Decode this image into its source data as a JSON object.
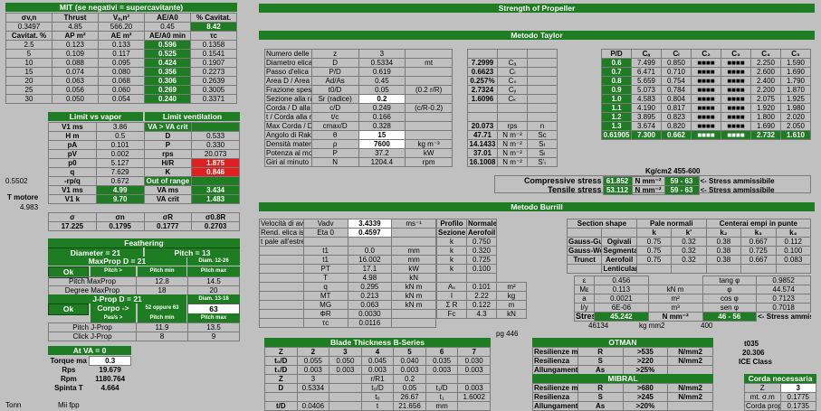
{
  "mit": {
    "title": "MIT (se negativi = supercavitante)",
    "h1": [
      "σv,n",
      "Thrust",
      "Vₐ,n²",
      "AE/A0",
      "% Cavitat."
    ],
    "r1": [
      "0.3497",
      "4.85",
      "566.20",
      "0.45",
      "8.42"
    ],
    "h2": [
      "Cavitat. %",
      "AP m²",
      "AE m²",
      "AE/A0 min",
      "τc"
    ],
    "rows": [
      [
        "2.5",
        "0.123",
        "0.133",
        "0.596",
        "0.1358"
      ],
      [
        "5",
        "0.109",
        "0.117",
        "0.525",
        "0.1541"
      ],
      [
        "10",
        "0.088",
        "0.095",
        "0.424",
        "0.1907"
      ],
      [
        "15",
        "0.074",
        "0.080",
        "0.356",
        "0.2273"
      ],
      [
        "20",
        "0.063",
        "0.068",
        "0.306",
        "0.2639"
      ],
      [
        "25",
        "0.056",
        "0.060",
        "0.269",
        "0.3005"
      ],
      [
        "30",
        "0.050",
        "0.054",
        "0.240",
        "0.3371"
      ]
    ]
  },
  "limit": {
    "t1": "Limit vs vapor",
    "t2": "Limit ventilation",
    "rows": [
      [
        "V1 ms",
        "3.86",
        "VA > VA crit",
        ""
      ],
      [
        "H m",
        "0.5",
        "D",
        "0.533"
      ],
      [
        "pA",
        "0.101",
        "P",
        "0.330"
      ],
      [
        "pV",
        "0.002",
        "rps",
        "20.073"
      ],
      [
        "p0",
        "5.127",
        "H/R",
        "1.875"
      ],
      [
        "q",
        "7.629",
        "K",
        "0.846"
      ],
      [
        "-rp/q",
        "0.672",
        "Out of range",
        ""
      ],
      [
        "V1 ms",
        "4.99",
        "VA ms",
        "3.434"
      ],
      [
        "V1 k",
        "9.70",
        "VA crit",
        "1.483"
      ]
    ],
    "sig_h": [
      "σ",
      "σn",
      "σR",
      "σ0.8R"
    ],
    "sig_v": [
      "17.225",
      "0.1795",
      "0.1777",
      "0.2703"
    ]
  },
  "left": {
    "v1": "0.5502",
    "motore": "T motore",
    "v2": "4.983",
    "tonn": "Tonn",
    "mifpp": "Mii fpp"
  },
  "feather": {
    "title": "Feathering",
    "dia": "Diameter = 21",
    "pitch": "Pitch = 13",
    "maxprop": "MaxProp  D = 21",
    "dim1": "Diam. 12-26",
    "ok": "Ok",
    "c1": "Pitch >",
    "c2": "Pitch min",
    "c3": "Pitch max",
    "r1l": "Pitch MaxProp",
    "r1a": "12.8",
    "r1b": "14.5",
    "r2l": "Degree MaxProp",
    "r2a": "18",
    "r2b": "20"
  },
  "jprop": {
    "title": "J-Prop  D = 21",
    "dim": "Diam. 13-18",
    "ok": "Ok",
    "corpo": "Corpo ->",
    "corpo_sub": "52 oppure 63",
    "corpo_v": "63",
    "c1": "Pas/s >",
    "c2": "Pitch min",
    "c3": "Pitch max",
    "r1l": "Pitch J-Prop",
    "r1a": "11.9",
    "r1b": "13.5",
    "r2l": "Click  J-Prop",
    "r2a": "8",
    "r2b": "9"
  },
  "atva": {
    "title": "At VA = 0",
    "rows": [
      [
        "Torque ma",
        "0.3"
      ],
      [
        "Rps",
        "19.679"
      ],
      [
        "Rpm",
        "1180.764"
      ],
      [
        "Spinta T",
        "4.664"
      ]
    ]
  },
  "strength": {
    "title": "Strength of Propeller"
  },
  "taylor": {
    "title": "Metodo Taylor",
    "rows": [
      [
        "Numero delle pale",
        "z",
        "3",
        ""
      ],
      [
        "Diametro elica",
        "D",
        "0.5334",
        "mt"
      ],
      [
        "Passo d'elica",
        "P/D",
        "0.619",
        ""
      ],
      [
        "Area D / Area S",
        "Ad/As",
        "0.45",
        ""
      ],
      [
        "Frazione spessore pala",
        "t0/D",
        "0.05",
        "(0.2 r/R)"
      ],
      [
        "Sezione alla radice",
        "Sr (radice)",
        "0.2",
        ""
      ],
      [
        "Corda / D alla radice",
        "c/D",
        "0.249",
        "(c/R-0.2)"
      ],
      [
        "t / Corda alla radice",
        "t/c",
        "0.166",
        ""
      ],
      [
        "Max Corda / D",
        "cmax/D",
        "0.328",
        ""
      ],
      [
        "Angolo di Rake",
        "θ",
        "15",
        ""
      ],
      [
        "Densità materiale elica",
        "ρ",
        "7600",
        "kg m⁻³"
      ],
      [
        "Potenza al mozzo elica",
        "P",
        "37.2",
        "kW"
      ],
      [
        "Giri al minuto",
        "N",
        "1204.4",
        "rpm"
      ]
    ],
    "mid": [
      [
        "",
        "",
        ""
      ],
      [
        "7.2999",
        "Cₐ",
        ""
      ],
      [
        "0.6623",
        "Cₗ",
        ""
      ],
      [
        "0.257%",
        "Cₛ",
        ""
      ],
      [
        "2.7324",
        "Cᵧ",
        ""
      ],
      [
        "1.6096",
        "Cₖ",
        ""
      ],
      [
        "",
        "",
        ""
      ],
      [
        "",
        "",
        ""
      ],
      [
        "20.073",
        "rps",
        "n"
      ],
      [
        "47.71",
        "N m⁻²",
        "Sc"
      ],
      [
        "14.1433",
        "N m⁻²",
        "Sₜ"
      ],
      [
        "37.01",
        "N m⁻²",
        "Sₗ"
      ],
      [
        "16.1008",
        "N m⁻²",
        "S'ₜ"
      ]
    ],
    "pd_h": [
      "P/D",
      "Cₐ",
      "Cₗ",
      "C₂",
      "C₃",
      "C₄",
      "C₅"
    ],
    "pd": [
      [
        "0.6",
        "7.499",
        "0.850",
        "■■■■",
        "■■■■",
        "2.250",
        "1.590"
      ],
      [
        "0.7",
        "6.471",
        "0.710",
        "■■■■",
        "■■■■",
        "2.600",
        "1.690"
      ],
      [
        "0.8",
        "5.659",
        "0.754",
        "■■■■",
        "■■■■",
        "2.400",
        "1.790"
      ],
      [
        "0.9",
        "5.073",
        "0.784",
        "■■■■",
        "■■■■",
        "2.200",
        "1.870"
      ],
      [
        "1.0",
        "4.583",
        "0.804",
        "■■■■",
        "■■■■",
        "2.075",
        "1.925"
      ],
      [
        "1.1",
        "4.190",
        "0.817",
        "■■■■",
        "■■■■",
        "1.920",
        "1.980"
      ],
      [
        "1.2",
        "3.895",
        "0.823",
        "■■■■",
        "■■■■",
        "1.800",
        "2.020"
      ],
      [
        "1.3",
        "3.674",
        "0.820",
        "■■■■",
        "■■■■",
        "1.690",
        "2.050"
      ]
    ],
    "pd_res": [
      "0.61905",
      "7.300",
      "0.662",
      "■■■■",
      "■■■■",
      "2.732",
      "1.610"
    ],
    "kg": "Kg/cm2  455-600",
    "comp_l": "Compressive stress",
    "comp_v": "61.852",
    "tens_l": "Tensile stress",
    "tens_v": "53.112",
    "unit": "N mm⁻²",
    "range": "59 - 63",
    "adm": "<- Stress ammissibile"
  },
  "burrill": {
    "title": "Metodo Burrill",
    "rows": [
      [
        "Velocità di avanzo",
        "Vadv",
        "3.4339",
        "ms⁻¹"
      ],
      [
        "Rend. elica isolata",
        "Eta 0",
        "0.4597",
        ""
      ],
      [
        "t pale all'estremità",
        "",
        "",
        ""
      ],
      [
        "",
        "t1",
        "0.0",
        "mm"
      ],
      [
        "",
        "t1",
        "16.002",
        "mm"
      ],
      [
        "",
        "PT",
        "17.1",
        "kW"
      ],
      [
        "",
        "T",
        "4.98",
        "kN"
      ],
      [
        "",
        "q",
        "0.295",
        "kN m"
      ],
      [
        "",
        "MT",
        "0.213",
        "kN m"
      ],
      [
        "",
        "MG",
        "0.063",
        "kN m"
      ],
      [
        "",
        "ΦR",
        "0.0030",
        ""
      ],
      [
        "",
        "τc",
        "0.0116",
        ""
      ]
    ],
    "prof": [
      [
        "Profilo",
        "Normale"
      ],
      [
        "Sezione",
        "Aerofoil"
      ],
      [
        "k",
        "0.750"
      ],
      [
        "k",
        "0.320"
      ],
      [
        "k",
        "0.725"
      ],
      [
        "k",
        "0.100"
      ],
      [
        "",
        ""
      ],
      [
        "Aₛ",
        "0.101",
        "m²"
      ],
      [
        "I",
        "2.22",
        "kg"
      ],
      [
        "Σ R",
        "0.122",
        "m"
      ],
      [
        "Fc",
        "4.3",
        "kN"
      ]
    ],
    "sec_h": [
      "Section shape",
      "Pale normali",
      "Centerai empi in punte"
    ],
    "sec_cols": [
      "",
      "",
      "k",
      "k'",
      "k₂",
      "k₃",
      "k₄"
    ],
    "sec": [
      [
        "Gauss-Guri",
        "Ogivali",
        "0.75",
        "0.32",
        "0.38",
        "0.667",
        "0.112"
      ],
      [
        "Gauss-Weg",
        "Segmental",
        "0.75",
        "0.32",
        "0.38",
        "0.725",
        "0.100"
      ],
      [
        "Trunct",
        "Aerofoil",
        "0.75",
        "0.32",
        "0.38",
        "0.667",
        "0.083"
      ],
      [
        "",
        "Lenticular",
        "",
        "",
        "",
        "",
        ""
      ]
    ],
    "res": [
      [
        "ε",
        "0.456",
        "tang φ",
        "0.9852"
      ],
      [
        "Mε",
        "0.113",
        "kN m",
        "φ",
        "44.574"
      ],
      [
        "a",
        "0.0021",
        "m²",
        "cos φ",
        "0.7123"
      ],
      [
        "I/y",
        "6E-06",
        "m³",
        "sen φ",
        "0.7018"
      ]
    ],
    "stress_l": "Stress",
    "stress_v": "45.242",
    "stress_u": "N mm⁻²",
    "stress_r": "46 - 56",
    "stress_a": "<- Stress ammissibile",
    "f1": "46134",
    "f2": "kg mm2",
    "f3": "400"
  },
  "pg": "pg 446",
  "blade": {
    "title": "Blade Thickness B-Series",
    "z_h": [
      "Z",
      "2",
      "3",
      "4",
      "5",
      "6",
      "7"
    ],
    "rows": [
      [
        "t₀/D",
        "0.055",
        "0.050",
        "0.045",
        "0.040",
        "0.035",
        "0.030"
      ],
      [
        "t₁/D",
        "0.003",
        "0.003",
        "0.003",
        "0.003",
        "0.003",
        "0.003"
      ],
      [
        "Z",
        "3",
        "",
        "r/R1",
        "0.2",
        "",
        ""
      ],
      [
        "D",
        "0.5334",
        "",
        "t₀/D",
        "0.05",
        "t₁/D",
        "0.003"
      ],
      [
        "",
        "",
        "",
        "t₀",
        "26.67",
        "t₁",
        "1.6002"
      ],
      [
        "t/D",
        "0.0406",
        "",
        "t",
        "21.656",
        "mm",
        ""
      ]
    ]
  },
  "otman": {
    "title": "OTMAN",
    "rows": [
      [
        "Resilienze meccaniche",
        "R",
        ">535",
        "N/mm2"
      ],
      [
        "Resilienza",
        "S",
        ">220",
        "N/mm2"
      ],
      [
        "Allungamento",
        "As",
        ">25%",
        ""
      ]
    ]
  },
  "mibral": {
    "title": "MIBRAL",
    "rows": [
      [
        "Resilienze meccaniche",
        "R",
        ">680",
        "N/mm2"
      ],
      [
        "Resilienza",
        "S",
        ">245",
        "N/mm2"
      ],
      [
        "Allungamento",
        "As",
        ">20%",
        ""
      ]
    ]
  },
  "ice": {
    "l1": "t035",
    "l2": "20.306",
    "l3": "ICE Class"
  },
  "corda": {
    "title": "Corda necessaria",
    "r1": [
      "Z",
      "3"
    ],
    "r2": [
      "mt. σ.m",
      "0.1775"
    ],
    "r3": [
      "Corda prop",
      "0.1735"
    ]
  }
}
